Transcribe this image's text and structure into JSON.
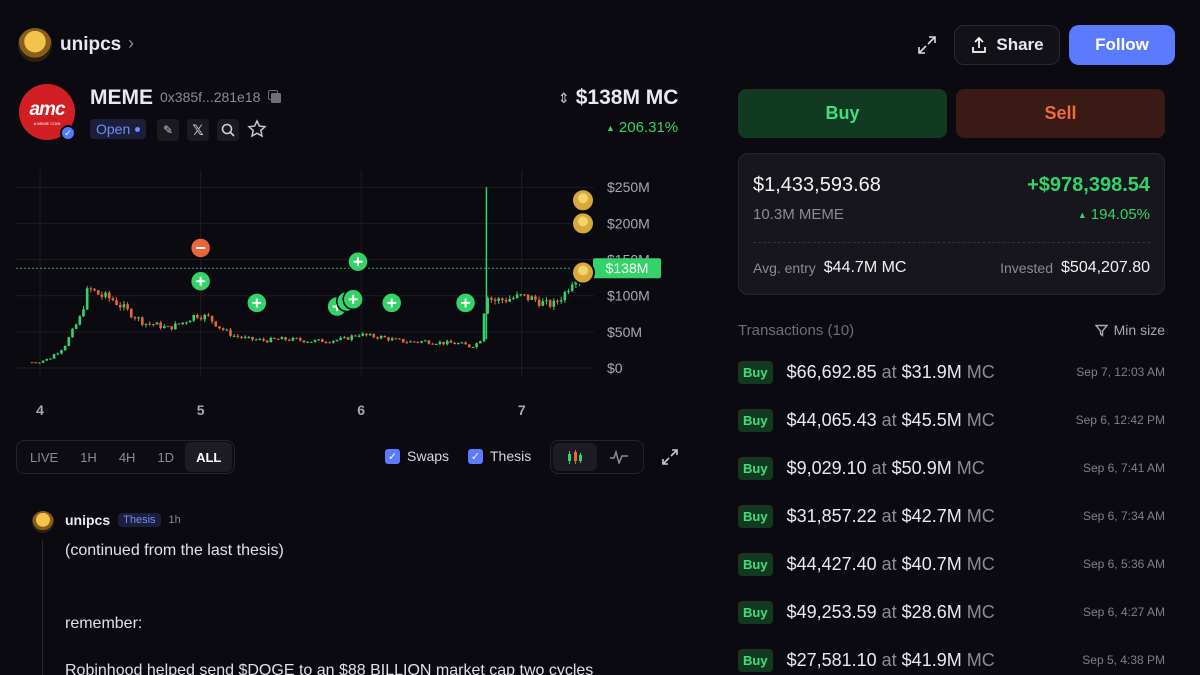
{
  "header": {
    "username": "unipcs",
    "share_label": "Share",
    "follow_label": "Follow"
  },
  "token": {
    "logo_text": "amc",
    "logo_subtext": "A MEME COIN",
    "symbol": "MEME",
    "address": "0x385f...281e18",
    "status": "Open",
    "market_cap": "$138M MC",
    "change": "206.31%"
  },
  "chart_data": {
    "type": "candlestick",
    "y_axis_labels": [
      "$250M",
      "$200M",
      "$150M",
      "$100M",
      "$50M",
      "$0"
    ],
    "y_ticks": [
      250,
      200,
      150,
      100,
      50,
      0
    ],
    "x_axis_labels": [
      "4",
      "5",
      "6",
      "7"
    ],
    "x_ticks": [
      4,
      5,
      6,
      7
    ],
    "current_price_label": "$138M",
    "current_price": 138,
    "xlim": [
      3.85,
      7.45
    ],
    "ylim": [
      0,
      260
    ],
    "price_path": [
      [
        3.95,
        8
      ],
      [
        4.05,
        12
      ],
      [
        4.15,
        30
      ],
      [
        4.25,
        70
      ],
      [
        4.3,
        110
      ],
      [
        4.38,
        100
      ],
      [
        4.45,
        95
      ],
      [
        4.55,
        78
      ],
      [
        4.65,
        62
      ],
      [
        4.72,
        60
      ],
      [
        4.8,
        55
      ],
      [
        4.9,
        64
      ],
      [
        4.97,
        74
      ],
      [
        5.05,
        70
      ],
      [
        5.12,
        56
      ],
      [
        5.2,
        45
      ],
      [
        5.3,
        40
      ],
      [
        5.4,
        38
      ],
      [
        5.5,
        40
      ],
      [
        5.6,
        39
      ],
      [
        5.7,
        37
      ],
      [
        5.8,
        38
      ],
      [
        5.9,
        40
      ],
      [
        5.98,
        47
      ],
      [
        6.05,
        44
      ],
      [
        6.12,
        43
      ],
      [
        6.2,
        39
      ],
      [
        6.3,
        36
      ],
      [
        6.4,
        37
      ],
      [
        6.5,
        35
      ],
      [
        6.6,
        34
      ],
      [
        6.68,
        30
      ],
      [
        6.74,
        36
      ],
      [
        6.78,
        105
      ],
      [
        6.82,
        93
      ],
      [
        6.9,
        95
      ],
      [
        7.0,
        99
      ],
      [
        7.08,
        95
      ],
      [
        7.15,
        88
      ],
      [
        7.2,
        88
      ],
      [
        7.27,
        104
      ],
      [
        7.32,
        125
      ],
      [
        7.36,
        138
      ]
    ],
    "spike": {
      "x": 6.78,
      "high": 250
    },
    "markers": [
      {
        "x": 5.0,
        "y": 166,
        "kind": "sell"
      },
      {
        "x": 5.0,
        "y": 120,
        "kind": "buy"
      },
      {
        "x": 5.35,
        "y": 90,
        "kind": "buy"
      },
      {
        "x": 5.98,
        "y": 147,
        "kind": "buy"
      },
      {
        "x": 5.85,
        "y": 85,
        "kind": "buy"
      },
      {
        "x": 5.91,
        "y": 92,
        "kind": "buy"
      },
      {
        "x": 5.95,
        "y": 95,
        "kind": "buy"
      },
      {
        "x": 6.19,
        "y": 90,
        "kind": "buy"
      },
      {
        "x": 6.65,
        "y": 90,
        "kind": "buy"
      }
    ],
    "avatar_markers": [
      232,
      200,
      132
    ]
  },
  "chart_controls": {
    "ranges": [
      "LIVE",
      "1H",
      "4H",
      "1D",
      "ALL"
    ],
    "active_range": "ALL",
    "swaps_label": "Swaps",
    "thesis_label": "Thesis"
  },
  "thesis": {
    "username": "unipcs",
    "tag": "Thesis",
    "time": "1h",
    "line1": "(continued from the last thesis)",
    "line2": "remember:",
    "line3": "Robinhood helped send $DOGE to an $88 BILLION market cap two cycles"
  },
  "trade": {
    "buy_label": "Buy",
    "sell_label": "Sell"
  },
  "position": {
    "value": "$1,433,593.68",
    "pnl": "+$978,398.54",
    "holdings": "10.3M MEME",
    "pnl_pct": "194.05%",
    "avg_entry_label": "Avg. entry",
    "avg_entry_value": "$44.7M MC",
    "invested_label": "Invested",
    "invested_value": "$504,207.80"
  },
  "transactions": {
    "title": "Transactions (10)",
    "filter_label": "Min size",
    "items": [
      {
        "side": "Buy",
        "amount": "$66,692.85",
        "at": "at",
        "mc": "$31.9M",
        "mc_unit": "MC",
        "date": "Sep 7, 12:03 AM"
      },
      {
        "side": "Buy",
        "amount": "$44,065.43",
        "at": "at",
        "mc": "$45.5M",
        "mc_unit": "MC",
        "date": "Sep 6, 12:42 PM"
      },
      {
        "side": "Buy",
        "amount": "$9,029.10",
        "at": "at",
        "mc": "$50.9M",
        "mc_unit": "MC",
        "date": "Sep 6, 7:41 AM"
      },
      {
        "side": "Buy",
        "amount": "$31,857.22",
        "at": "at",
        "mc": "$42.7M",
        "mc_unit": "MC",
        "date": "Sep 6, 7:34 AM"
      },
      {
        "side": "Buy",
        "amount": "$44,427.40",
        "at": "at",
        "mc": "$40.7M",
        "mc_unit": "MC",
        "date": "Sep 6, 5:36 AM"
      },
      {
        "side": "Buy",
        "amount": "$49,253.59",
        "at": "at",
        "mc": "$28.6M",
        "mc_unit": "MC",
        "date": "Sep 6, 4:27 AM"
      },
      {
        "side": "Buy",
        "amount": "$27,581.10",
        "at": "at",
        "mc": "$41.9M",
        "mc_unit": "MC",
        "date": "Sep 5, 4:38 PM"
      }
    ]
  },
  "colors": {
    "up": "#34d36a",
    "down": "#e8673a",
    "accent": "#5b7bff"
  }
}
